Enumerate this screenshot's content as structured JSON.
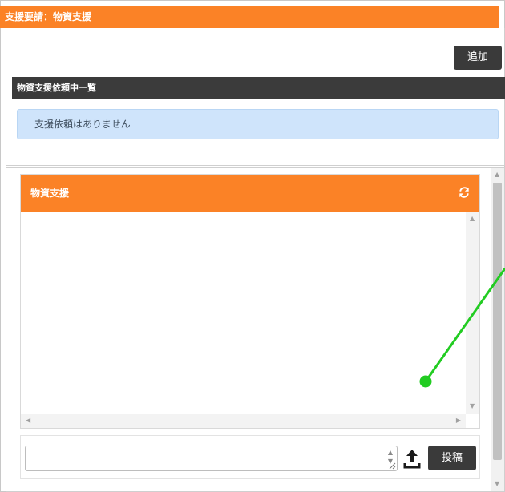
{
  "request_panel": {
    "header_title": "支援要請：物資支援",
    "add_button_label": "追加",
    "list_header": "物資支援依頼中一覧",
    "empty_message": "支援依頼はありません"
  },
  "chat_panel": {
    "header_title": "物資支援",
    "refresh_icon": "refresh-icon",
    "message_input_value": "",
    "upload_icon": "upload-icon",
    "post_button_label": "投稿"
  },
  "colors": {
    "accent_orange": "#fb8226",
    "dark_header": "#3b3b3b",
    "info_background": "#cfe4fb",
    "annotation_green": "#22cc22"
  }
}
